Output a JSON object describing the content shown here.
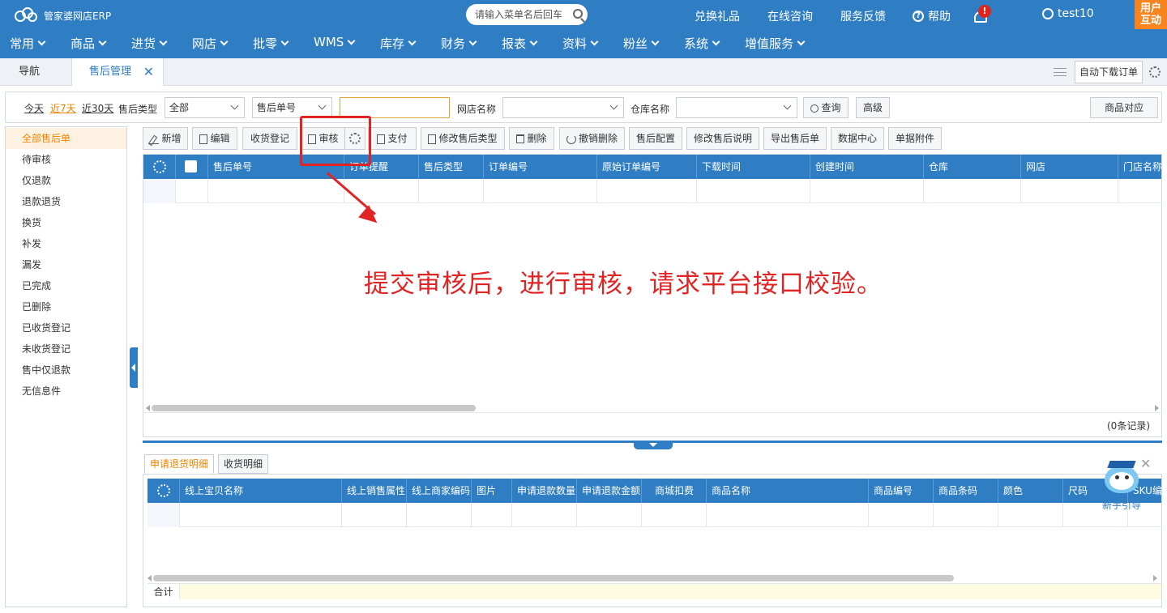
{
  "app": {
    "logo_text": "管家婆网店ERP",
    "search_placeholder": "请输入菜单名后回车",
    "top_links": [
      "兑换礼品",
      "在线咨询",
      "服务反馈",
      "帮助"
    ],
    "notification_badge": "!",
    "username": "test10",
    "interact_line1": "用户",
    "interact_line2": "互动",
    "brand_color": "#2f7ec4",
    "accent_color": "#f7841e",
    "annotation_color": "#e02424"
  },
  "menu": [
    "常用",
    "商品",
    "进货",
    "网店",
    "批零",
    "WMS",
    "库存",
    "财务",
    "报表",
    "资料",
    "粉丝",
    "系统",
    "增值服务"
  ],
  "tabs": {
    "nav": "导航",
    "active": "售后管理",
    "close_glyph": "✕",
    "auto_download": "自动下载订单"
  },
  "filter": {
    "today": "今天",
    "last7": "近7天",
    "last30": "近30天",
    "type_label": "售后类型",
    "type_value": "全部",
    "field_value": "售后单号",
    "shop_label": "网店名称",
    "warehouse_label": "仓库名称",
    "query": "查询",
    "advanced": "高级",
    "product_match": "商品对应"
  },
  "left_nav": [
    "全部售后单",
    "待审核",
    "仅退款",
    "退款退货",
    "换货",
    "补发",
    "漏发",
    "已完成",
    "已删除",
    "已收货登记",
    "未收货登记",
    "售中仅退款",
    "无信息件"
  ],
  "toolbar": {
    "add": "新增",
    "edit": "编辑",
    "receive": "收货登记",
    "audit": "审核",
    "pay": "支付",
    "change_type": "修改售后类型",
    "delete": "删除",
    "undo_delete": "撤销删除",
    "config": "售后配置",
    "change_desc": "修改售后说明",
    "export": "导出售后单",
    "data_center": "数据中心",
    "attachments": "单据附件"
  },
  "main_grid": {
    "columns": [
      "售后单号",
      "订单提醒",
      "售后类型",
      "订单编号",
      "原始订单编号",
      "下载时间",
      "创建时间",
      "仓库",
      "网店",
      "门店名称"
    ],
    "record_count": "(0条记录)"
  },
  "annotation": "提交审核后，进行审核，请求平台接口校验。",
  "detail": {
    "tab_active": "申请退货明细",
    "tab_other": "收货明细",
    "columns": [
      "线上宝贝名称",
      "线上销售属性",
      "线上商家编码",
      "图片",
      "申请退款数量",
      "申请退款金额",
      "商城扣费",
      "商品名称",
      "商品编号",
      "商品条码",
      "颜色",
      "尺码",
      "SKU编"
    ],
    "sum_label": "合计"
  },
  "guide": {
    "label": "新手引导",
    "close_glyph": "✕"
  }
}
